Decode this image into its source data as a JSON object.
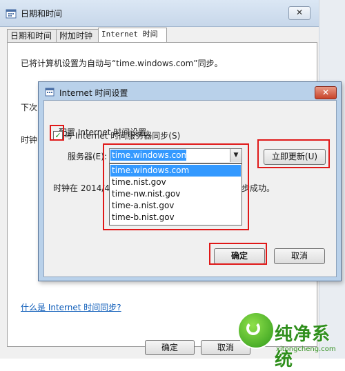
{
  "outer_window": {
    "title": "日期和时间",
    "close_glyph": "✕",
    "tabs": [
      {
        "label": "日期和时间"
      },
      {
        "label": "附加时钟"
      },
      {
        "label": "Internet 时间"
      }
    ],
    "sync_info": "已将计算机设置为自动与“time.windows.com”同步。",
    "partial_next": "下次",
    "partial_clock": "时钟",
    "help_link": "什么是 Internet 时间同步?",
    "ok_label": "确定",
    "cancel_label": "取消"
  },
  "dialog": {
    "title": "Internet 时间设置",
    "close_glyph": "✕",
    "config_label": "配置 Internet 时间设置:",
    "sync_checkbox": {
      "label": "与 Internet 时间服务器同步(S)",
      "checked": true,
      "check_glyph": "✓"
    },
    "server_label": "服务器(E):",
    "server_value": "time.windows.com",
    "combo_arrow": "▼",
    "update_label": "立即更新(U)",
    "dropdown_options": [
      "time.windows.com",
      "time.nist.gov",
      "time-nw.nist.gov",
      "time-a.nist.gov",
      "time-b.nist.gov"
    ],
    "selected_option": "time.windows.com",
    "result_prefix": "时钟在 2014/4",
    "result_suffix": "步成功。",
    "ok_label": "确定",
    "cancel_label": "取消"
  },
  "watermark": {
    "text": "纯净系统",
    "url": "xitongcheng.com"
  },
  "colors": {
    "highlight": "#e01818",
    "selection": "#3399ff",
    "dialog_frame": "#b9d1ea",
    "link": "#0a5ab8"
  }
}
